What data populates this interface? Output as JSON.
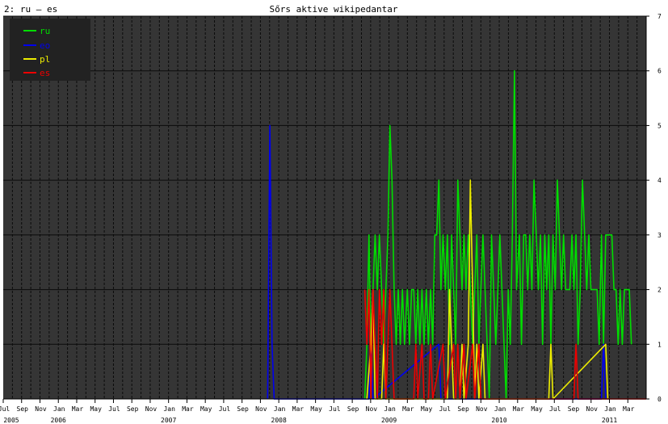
{
  "header": {
    "chart_id": "2: ru – es",
    "title": "Sőrs aktive wikipedantar"
  },
  "colors": {
    "plot_bg": "#353535",
    "grid": "#0b0b0b",
    "ru": "#00dd00",
    "eo": "#0000ee",
    "pl": "#eeee00",
    "es": "#ee0000"
  },
  "chart_data": {
    "type": "line",
    "title": "Sőrs aktive wikipedantar",
    "xlabel": "",
    "ylabel": "",
    "x_range": [
      "2005-07",
      "2011-05"
    ],
    "ylim": [
      0,
      7
    ],
    "yticks": [
      0,
      1,
      2,
      3,
      4,
      5,
      6,
      7
    ],
    "y_axis_side": "right",
    "grid": true,
    "legend_position": "top-left",
    "month_tick_labels": [
      "Jul",
      "Sep",
      "Nov",
      "Jan",
      "Mar",
      "May",
      "Jul",
      "Sep",
      "Nov",
      "Jan",
      "Mar",
      "May",
      "Jul",
      "Sep",
      "Nov",
      "Jan",
      "Mar",
      "May",
      "Jul",
      "Sep",
      "Nov",
      "Jan",
      "Mar",
      "May",
      "Jul",
      "Sep",
      "Nov",
      "Jan",
      "Mar",
      "May",
      "Jul",
      "Sep",
      "Nov",
      "Jan",
      "Mar"
    ],
    "year_tick_labels": [
      "2005",
      "2006",
      "2007",
      "2008",
      "2009",
      "2010",
      "2011"
    ],
    "series": [
      {
        "name": "ru",
        "color": "#00dd00",
        "points": [
          [
            "2008-10-12",
            0
          ],
          [
            "2008-10-19",
            1
          ],
          [
            "2008-10-26",
            3
          ],
          [
            "2008-11-02",
            1
          ],
          [
            "2008-11-09",
            2
          ],
          [
            "2008-11-16",
            3
          ],
          [
            "2008-11-23",
            2
          ],
          [
            "2008-11-30",
            3
          ],
          [
            "2008-12-07",
            2
          ],
          [
            "2008-12-14",
            1
          ],
          [
            "2008-12-21",
            2
          ],
          [
            "2008-12-28",
            3
          ],
          [
            "2009-01-04",
            5
          ],
          [
            "2009-01-11",
            4
          ],
          [
            "2009-01-18",
            2
          ],
          [
            "2009-01-25",
            1
          ],
          [
            "2009-02-01",
            2
          ],
          [
            "2009-02-08",
            1
          ],
          [
            "2009-02-15",
            2
          ],
          [
            "2009-02-22",
            1
          ],
          [
            "2009-03-01",
            2
          ],
          [
            "2009-03-08",
            1
          ],
          [
            "2009-03-15",
            2
          ],
          [
            "2009-03-22",
            2
          ],
          [
            "2009-03-29",
            1
          ],
          [
            "2009-04-05",
            2
          ],
          [
            "2009-04-12",
            1
          ],
          [
            "2009-04-19",
            2
          ],
          [
            "2009-04-26",
            1
          ],
          [
            "2009-05-03",
            2
          ],
          [
            "2009-05-10",
            1
          ],
          [
            "2009-05-17",
            2
          ],
          [
            "2009-05-24",
            1
          ],
          [
            "2009-05-31",
            3
          ],
          [
            "2009-06-07",
            3
          ],
          [
            "2009-06-14",
            4
          ],
          [
            "2009-06-21",
            2
          ],
          [
            "2009-06-28",
            3
          ],
          [
            "2009-07-05",
            2
          ],
          [
            "2009-07-12",
            3
          ],
          [
            "2009-07-19",
            1
          ],
          [
            "2009-07-26",
            3
          ],
          [
            "2009-08-02",
            2
          ],
          [
            "2009-08-09",
            1
          ],
          [
            "2009-08-16",
            4
          ],
          [
            "2009-08-23",
            3
          ],
          [
            "2009-08-30",
            2
          ],
          [
            "2009-09-06",
            3
          ],
          [
            "2009-09-13",
            2
          ],
          [
            "2009-09-20",
            3
          ],
          [
            "2009-09-27",
            2
          ],
          [
            "2009-10-04",
            1
          ],
          [
            "2009-10-11",
            2
          ],
          [
            "2009-10-18",
            3
          ],
          [
            "2009-10-25",
            1
          ],
          [
            "2009-11-01",
            2
          ],
          [
            "2009-11-08",
            3
          ],
          [
            "2009-11-15",
            2
          ],
          [
            "2009-11-22",
            1
          ],
          [
            "2009-11-29",
            0
          ],
          [
            "2009-12-06",
            3
          ],
          [
            "2009-12-13",
            2
          ],
          [
            "2009-12-20",
            1
          ],
          [
            "2009-12-27",
            2
          ],
          [
            "2010-01-03",
            3
          ],
          [
            "2010-01-10",
            2
          ],
          [
            "2010-01-17",
            1
          ],
          [
            "2010-01-24",
            0
          ],
          [
            "2010-01-31",
            2
          ],
          [
            "2010-02-07",
            1
          ],
          [
            "2010-02-14",
            3
          ],
          [
            "2010-02-21",
            6
          ],
          [
            "2010-02-28",
            2
          ],
          [
            "2010-03-07",
            3
          ],
          [
            "2010-03-14",
            1
          ],
          [
            "2010-03-21",
            3
          ],
          [
            "2010-03-28",
            3
          ],
          [
            "2010-04-04",
            2
          ],
          [
            "2010-04-11",
            3
          ],
          [
            "2010-04-18",
            2
          ],
          [
            "2010-04-25",
            4
          ],
          [
            "2010-05-02",
            3
          ],
          [
            "2010-05-09",
            2
          ],
          [
            "2010-05-16",
            3
          ],
          [
            "2010-05-23",
            1
          ],
          [
            "2010-05-30",
            3
          ],
          [
            "2010-06-06",
            2
          ],
          [
            "2010-06-13",
            3
          ],
          [
            "2010-06-20",
            1
          ],
          [
            "2010-06-27",
            3
          ],
          [
            "2010-07-04",
            2
          ],
          [
            "2010-07-11",
            4
          ],
          [
            "2010-07-18",
            3
          ],
          [
            "2010-07-25",
            2
          ],
          [
            "2010-08-01",
            3
          ],
          [
            "2010-08-08",
            2
          ],
          [
            "2010-08-15",
            2
          ],
          [
            "2010-08-22",
            2
          ],
          [
            "2010-08-29",
            3
          ],
          [
            "2010-09-05",
            2
          ],
          [
            "2010-09-12",
            3
          ],
          [
            "2010-09-19",
            1
          ],
          [
            "2010-09-26",
            2
          ],
          [
            "2010-10-03",
            4
          ],
          [
            "2010-10-10",
            3
          ],
          [
            "2010-10-17",
            2
          ],
          [
            "2010-10-24",
            3
          ],
          [
            "2010-10-31",
            2
          ],
          [
            "2010-11-07",
            2
          ],
          [
            "2010-11-14",
            2
          ],
          [
            "2010-11-21",
            2
          ],
          [
            "2010-11-28",
            1
          ],
          [
            "2010-12-05",
            3
          ],
          [
            "2010-12-12",
            1
          ],
          [
            "2010-12-19",
            3
          ],
          [
            "2010-12-26",
            3
          ],
          [
            "2011-01-09",
            3
          ],
          [
            "2011-01-16",
            2
          ],
          [
            "2011-01-23",
            2
          ],
          [
            "2011-01-30",
            1
          ],
          [
            "2011-02-06",
            2
          ],
          [
            "2011-02-13",
            1
          ],
          [
            "2011-02-20",
            2
          ],
          [
            "2011-02-27",
            2
          ],
          [
            "2011-03-06",
            2
          ],
          [
            "2011-03-13",
            1
          ]
        ]
      },
      {
        "name": "eo",
        "color": "#0000ee",
        "points": [
          [
            "2007-11-25",
            0
          ],
          [
            "2007-12-02",
            5
          ],
          [
            "2007-12-09",
            1
          ],
          [
            "2007-12-16",
            0
          ],
          [
            "2008-10-26",
            0
          ],
          [
            "2008-11-02",
            1
          ],
          [
            "2008-11-09",
            0
          ],
          [
            "2009-06-14",
            1
          ],
          [
            "2009-06-21",
            0
          ],
          [
            "2010-12-05",
            0
          ],
          [
            "2010-12-12",
            1
          ],
          [
            "2010-12-19",
            0
          ]
        ]
      },
      {
        "name": "pl",
        "color": "#eeee00",
        "points": [
          [
            "2008-10-19",
            0
          ],
          [
            "2008-11-02",
            1
          ],
          [
            "2008-11-09",
            2
          ],
          [
            "2008-11-16",
            0
          ],
          [
            "2008-12-07",
            0
          ],
          [
            "2008-12-14",
            1
          ],
          [
            "2008-12-21",
            0
          ],
          [
            "2009-07-12",
            0
          ],
          [
            "2009-07-19",
            2
          ],
          [
            "2009-07-26",
            1
          ],
          [
            "2009-08-02",
            0
          ],
          [
            "2009-08-23",
            0
          ],
          [
            "2009-08-30",
            1
          ],
          [
            "2009-09-06",
            0
          ],
          [
            "2009-09-20",
            1
          ],
          [
            "2009-09-27",
            4
          ],
          [
            "2009-10-04",
            2
          ],
          [
            "2009-10-11",
            0
          ],
          [
            "2009-10-18",
            1
          ],
          [
            "2009-10-25",
            0
          ],
          [
            "2009-11-08",
            1
          ],
          [
            "2009-11-15",
            0
          ],
          [
            "2010-06-13",
            0
          ],
          [
            "2010-06-20",
            1
          ],
          [
            "2010-06-27",
            0
          ],
          [
            "2010-12-19",
            1
          ],
          [
            "2010-12-26",
            0
          ]
        ]
      },
      {
        "name": "es",
        "color": "#ee0000",
        "points": [
          [
            "2008-10-12",
            2
          ],
          [
            "2008-10-19",
            1
          ],
          [
            "2008-10-26",
            2
          ],
          [
            "2008-11-02",
            0
          ],
          [
            "2008-11-09",
            2
          ],
          [
            "2008-11-16",
            1
          ],
          [
            "2008-11-23",
            0
          ],
          [
            "2008-11-30",
            2
          ],
          [
            "2008-12-07",
            1
          ],
          [
            "2008-12-14",
            2
          ],
          [
            "2008-12-21",
            0
          ],
          [
            "2008-12-28",
            1
          ],
          [
            "2009-01-04",
            2
          ],
          [
            "2009-01-11",
            1
          ],
          [
            "2009-01-18",
            0
          ],
          [
            "2009-03-22",
            0
          ],
          [
            "2009-03-29",
            1
          ],
          [
            "2009-04-05",
            0
          ],
          [
            "2009-04-19",
            1
          ],
          [
            "2009-04-26",
            0
          ],
          [
            "2009-05-10",
            0
          ],
          [
            "2009-05-17",
            1
          ],
          [
            "2009-05-24",
            0
          ],
          [
            "2009-06-28",
            1
          ],
          [
            "2009-07-05",
            0
          ],
          [
            "2009-08-02",
            1
          ],
          [
            "2009-08-09",
            0
          ],
          [
            "2009-08-16",
            1
          ],
          [
            "2009-08-23",
            0
          ],
          [
            "2009-09-06",
            1
          ],
          [
            "2009-09-13",
            0
          ],
          [
            "2009-10-04",
            1
          ],
          [
            "2009-10-11",
            0
          ],
          [
            "2009-10-25",
            1
          ],
          [
            "2009-11-01",
            0
          ],
          [
            "2010-09-05",
            0
          ],
          [
            "2010-09-12",
            1
          ],
          [
            "2010-09-19",
            0
          ],
          [
            "2011-05-01",
            0
          ]
        ]
      }
    ]
  }
}
